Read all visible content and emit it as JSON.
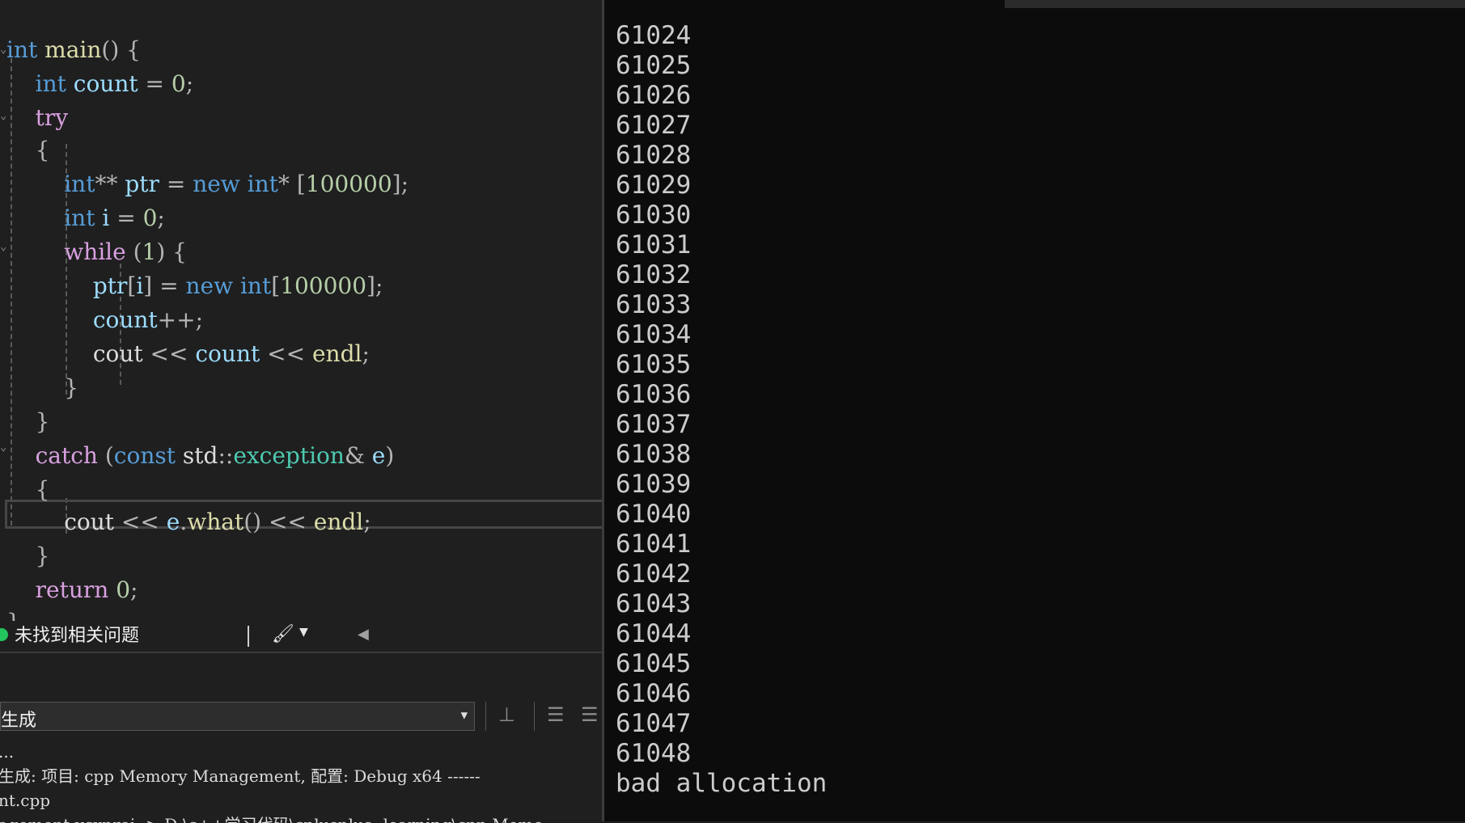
{
  "editor": {
    "lines": [
      [
        [
          "kw",
          "int"
        ],
        [
          "plain",
          " "
        ],
        [
          "fn",
          "main"
        ],
        [
          "op",
          "() {"
        ]
      ],
      [
        [
          "plain",
          "    "
        ],
        [
          "kw",
          "int"
        ],
        [
          "plain",
          " "
        ],
        [
          "var",
          "count"
        ],
        [
          "op",
          " = "
        ],
        [
          "num",
          "0"
        ],
        [
          "op",
          ";"
        ]
      ],
      [
        [
          "plain",
          "    "
        ],
        [
          "ctl",
          "try"
        ]
      ],
      [
        [
          "plain",
          "    "
        ],
        [
          "op",
          "{"
        ]
      ],
      [
        [
          "plain",
          "        "
        ],
        [
          "kw",
          "int"
        ],
        [
          "op",
          "** "
        ],
        [
          "var",
          "ptr"
        ],
        [
          "op",
          " = "
        ],
        [
          "kw",
          "new"
        ],
        [
          "plain",
          " "
        ],
        [
          "kw",
          "int"
        ],
        [
          "op",
          "* ["
        ],
        [
          "num",
          "100000"
        ],
        [
          "op",
          "];"
        ]
      ],
      [
        [
          "plain",
          "        "
        ],
        [
          "kw",
          "int"
        ],
        [
          "plain",
          " "
        ],
        [
          "var",
          "i"
        ],
        [
          "op",
          " = "
        ],
        [
          "num",
          "0"
        ],
        [
          "op",
          ";"
        ]
      ],
      [
        [
          "plain",
          "        "
        ],
        [
          "ctl",
          "while"
        ],
        [
          "op",
          " ("
        ],
        [
          "num",
          "1"
        ],
        [
          "op",
          ") {"
        ]
      ],
      [
        [
          "plain",
          "            "
        ],
        [
          "var",
          "ptr"
        ],
        [
          "op",
          "["
        ],
        [
          "var",
          "i"
        ],
        [
          "op",
          "] = "
        ],
        [
          "kw",
          "new"
        ],
        [
          "plain",
          " "
        ],
        [
          "kw",
          "int"
        ],
        [
          "op",
          "["
        ],
        [
          "num",
          "100000"
        ],
        [
          "op",
          "];"
        ]
      ],
      [
        [
          "plain",
          "            "
        ],
        [
          "var",
          "count"
        ],
        [
          "op",
          "++;"
        ]
      ],
      [
        [
          "plain",
          "            "
        ],
        [
          "plain",
          "cout"
        ],
        [
          "op",
          " << "
        ],
        [
          "var",
          "count"
        ],
        [
          "op",
          " << "
        ],
        [
          "fn",
          "endl"
        ],
        [
          "op",
          ";"
        ]
      ],
      [
        [
          "plain",
          "        "
        ],
        [
          "op",
          "}"
        ]
      ],
      [
        [
          "plain",
          "    "
        ],
        [
          "op",
          "}"
        ]
      ],
      [
        [
          "plain",
          "    "
        ],
        [
          "ctl",
          "catch"
        ],
        [
          "op",
          " ("
        ],
        [
          "kw",
          "const"
        ],
        [
          "plain",
          " std"
        ],
        [
          "op",
          "::"
        ],
        [
          "typ",
          "exception"
        ],
        [
          "op",
          "& "
        ],
        [
          "var",
          "e"
        ],
        [
          "op",
          ")"
        ]
      ],
      [
        [
          "plain",
          "    "
        ],
        [
          "op",
          "{"
        ]
      ],
      [
        [
          "plain",
          "        "
        ],
        [
          "plain",
          "cout"
        ],
        [
          "op",
          " << "
        ],
        [
          "var",
          "e"
        ],
        [
          "op",
          "."
        ],
        [
          "fn",
          "what"
        ],
        [
          "op",
          "() << "
        ],
        [
          "fn",
          "endl"
        ],
        [
          "op",
          ";"
        ]
      ],
      [
        [
          "plain",
          "    "
        ],
        [
          "op",
          "}"
        ]
      ],
      [
        [
          "plain",
          "    "
        ],
        [
          "ctl",
          "return"
        ],
        [
          "plain",
          " "
        ],
        [
          "num",
          "0"
        ],
        [
          "op",
          ";"
        ]
      ],
      [
        [
          "op",
          "}"
        ]
      ]
    ]
  },
  "status_bar": {
    "message": "未找到相关问题"
  },
  "output_panel": {
    "source_selected": "生成",
    "lines": [
      "...",
      "生成: 项目: cpp Memory Management, 配置: Debug x64 ------",
      "nt.cpp",
      "agement.vcxproj -> D:\\c++学习代码\\cplusplus--learning\\cpp Memo"
    ]
  },
  "console": {
    "lines": [
      "61024",
      "61025",
      "61026",
      "61027",
      "61028",
      "61029",
      "61030",
      "61031",
      "61032",
      "61033",
      "61034",
      "61035",
      "61036",
      "61037",
      "61038",
      "61039",
      "61040",
      "61041",
      "61042",
      "61043",
      "61044",
      "61045",
      "61046",
      "61047",
      "61048",
      "bad allocation"
    ]
  }
}
